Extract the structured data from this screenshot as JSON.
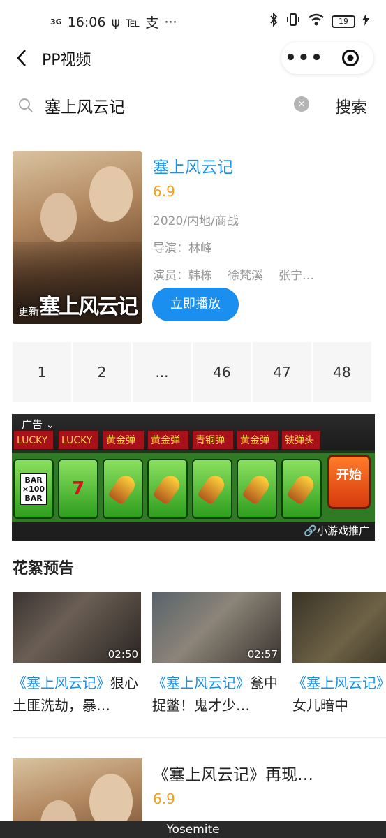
{
  "status": {
    "network": "3G",
    "time": "16:06",
    "usb": "ψ",
    "app1": "℡",
    "app2": "支",
    "more": "···",
    "battery": "19"
  },
  "navbar": {
    "title": "PP视频",
    "more": "•••"
  },
  "search": {
    "value": "塞上风云记",
    "button_label": "搜索",
    "clear": "×"
  },
  "movie": {
    "title": "塞上风云记",
    "score": "6.9",
    "meta": "2020/内地/商战",
    "director_label": "导演：",
    "director": "林峰",
    "actors_label": "演员：",
    "actors": [
      "韩栋",
      "徐梵溪",
      "张宁…"
    ],
    "poster_update": "更新",
    "poster_logo": "塞上风云记",
    "play_label": "立即播放"
  },
  "episodes": [
    "1",
    "2",
    "...",
    "46",
    "47",
    "48"
  ],
  "ad": {
    "label": "广告",
    "cta": "开始",
    "tags": [
      "LUCKY",
      "LUCKY",
      "黄金弹头",
      "黄金弹头",
      "青铜弹头",
      "黄金弹头",
      "铁弹头"
    ],
    "footer": "小游戏推广"
  },
  "section": {
    "title": "花絮预告"
  },
  "trailers": [
    {
      "title_hl": "《塞上风云记》",
      "title_rest": "狠心土匪洗劫，暴…",
      "duration": "02:50"
    },
    {
      "title_hl": "《塞上风云记》",
      "title_rest": "瓮中捉鳖！鬼才少…",
      "duration": "02:57"
    },
    {
      "title_hl": "《塞上风云记》",
      "title_rest": "世年女儿暗中",
      "duration": ""
    }
  ],
  "movie2": {
    "title": "《塞上风云记》再现…",
    "score": "6.9"
  },
  "bottom_label": "Yosemite"
}
